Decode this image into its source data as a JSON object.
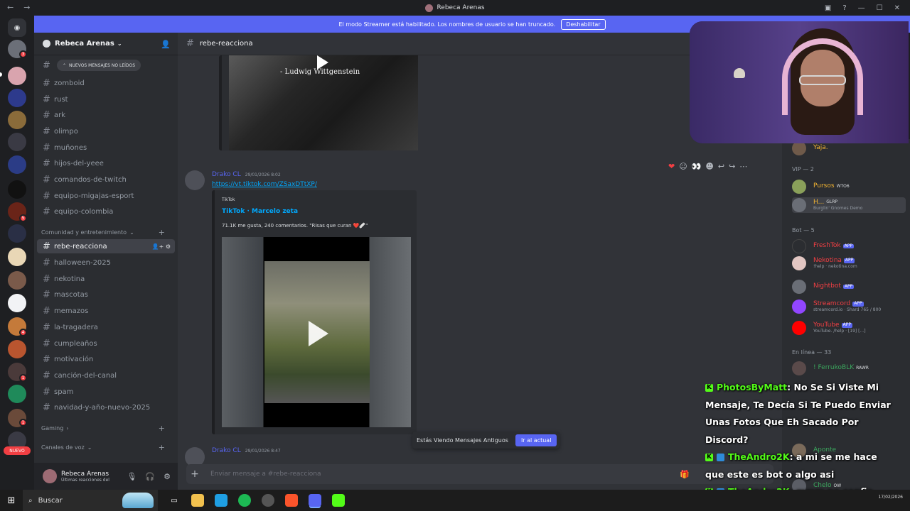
{
  "window": {
    "title": "Rebeca Arenas"
  },
  "banner": {
    "text": "El modo Streamer está habilitado. Los nombres de usuario se han truncado.",
    "button": "Deshabilitar"
  },
  "rail": {
    "badges": [
      "3",
      "5",
      "4",
      "1",
      "1"
    ],
    "nuevo_label": "NUEVO"
  },
  "guild": {
    "name": "Rebeca Arenas",
    "unread_pill": "NUEVOS MENSAJES NO LEÍDOS",
    "channels_top": [
      "zomboid",
      "rust",
      "ark",
      "olimpo",
      "muñones",
      "hijos-del-yeee",
      "comandos-de-twitch",
      "equipo-migajas-esport",
      "equipo-colombia"
    ],
    "category_community": "Comunidad y entretenimiento",
    "channels_community": [
      "rebe-reacciona",
      "halloween-2025",
      "nekotina",
      "mascotas",
      "memazos",
      "la-tragadera",
      "cumpleaños",
      "motivación",
      "canción-del-canal",
      "spam",
      "navidad-y-año-nuevo-2025"
    ],
    "category_gaming": "Gaming",
    "category_voice": "Canales de voz"
  },
  "user_panel": {
    "name": "Rebeca Arenas",
    "status": "Últimas reacciones del"
  },
  "chat": {
    "channel_name": "rebe-reacciona",
    "video1_quote": "- Ludwig Wittgenstein",
    "message1": {
      "author": "Drako CL",
      "time": "29/01/2026 8:02",
      "link": "https://vt.tiktok.com/ZSaxDTtXP/"
    },
    "embed": {
      "provider": "TikTok",
      "title": "TikTok · Marcelo zeta",
      "description": "71.1K me gusta, 240 comentarios. \"Risas que curan ❤️🩹\""
    },
    "message2": {
      "author": "Drako CL",
      "time": "29/01/2026 8:47"
    },
    "old_messages": "Estás Viendo Mensajes Antiguos",
    "jump_button": "Ir al actual",
    "composer_placeholder": "Enviar mensaje a #rebe-reacciona"
  },
  "members": {
    "top_partial": "Yaja.",
    "vip_header": "VIP — 2",
    "vip": [
      {
        "name": "Pursos",
        "tag": "WTO6",
        "color": "#f0b232"
      },
      {
        "name": "H...",
        "tag": "GLRP",
        "sub": "Burglin' Gnomes Demo",
        "color": "#f0b232"
      }
    ],
    "bot_header": "Bot — 5",
    "bots": [
      {
        "name": "FreshTok",
        "tag": "APP",
        "color": "#f23f43"
      },
      {
        "name": "Nekotina",
        "tag": "APP",
        "sub": "!help · nekotina.com",
        "color": "#f23f43"
      },
      {
        "name": "Nightbot",
        "tag": "APP",
        "color": "#f23f43"
      },
      {
        "name": "Streamcord",
        "tag": "APP",
        "sub": "streamcord.io · Shard 765 / 800",
        "color": "#f23f43"
      },
      {
        "name": "YouTube",
        "tag": "APP",
        "sub": "YouTube. /help · [19] [...]",
        "color": "#f23f43"
      }
    ],
    "online_header": "En línea — 33",
    "online": [
      {
        "name": "! FerrukoBLK",
        "tag": "RAWR",
        "color": "#3ba55d"
      },
      {
        "name": "Aponte",
        "color": "#3ba55d"
      },
      {
        "name": "Chelo",
        "tag": "OW",
        "color": "#3ba55d"
      }
    ]
  },
  "stream_chat": [
    {
      "user": "PhotosByMatt",
      "text": ": No Se Si Viste Mi"
    },
    {
      "text": "Mensaje, Te Decía Si Te Puedo Enviar"
    },
    {
      "text": "Unas Fotos Que Eh Sacado Por"
    },
    {
      "text": "Discord?"
    },
    {
      "user": "TheAndro2K",
      "text": ": a mi se me hace"
    },
    {
      "text": "que este es bot o algo asi"
    },
    {
      "user": "TheAndro2K",
      "text": ": mmm no confio"
    }
  ],
  "taskbar": {
    "search": "Buscar",
    "date": "17/02/2026"
  }
}
